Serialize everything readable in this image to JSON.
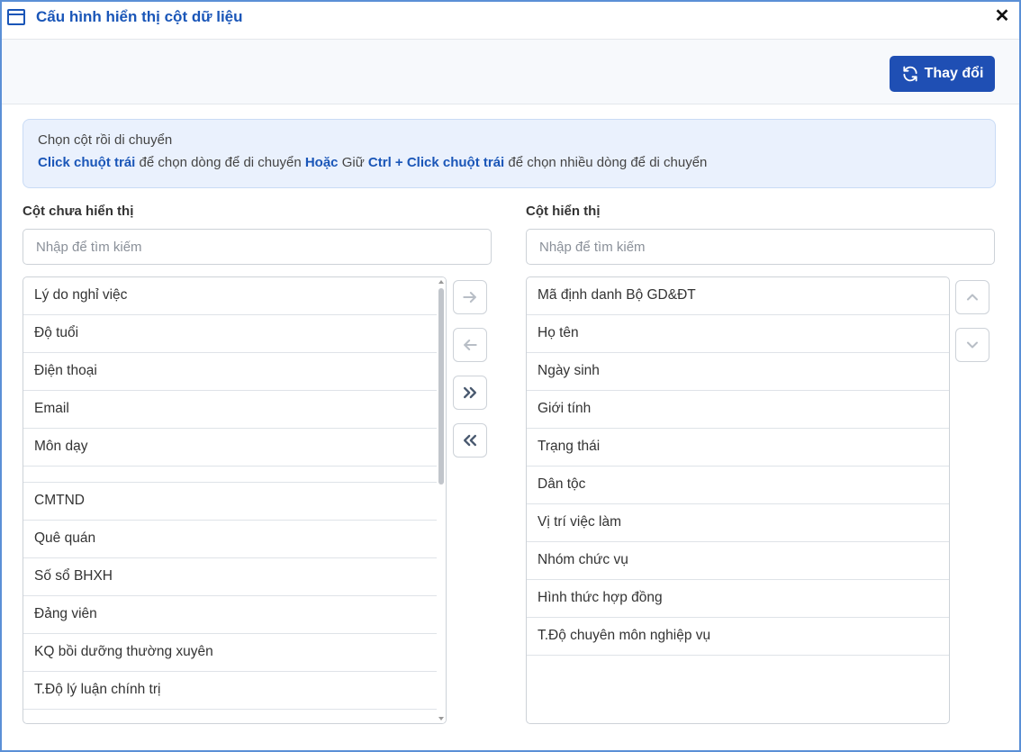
{
  "dialog": {
    "title": "Cấu hình hiển thị cột dữ liệu",
    "close_glyph": "✕",
    "change_label": "Thay đổi"
  },
  "info": {
    "line1": "Chọn cột rồi di chuyển",
    "click_left": "Click chuột trái",
    "text_a": " để chọn dòng để di chuyển ",
    "or": "Hoặc",
    "text_b": " Giữ ",
    "ctrl_click": "Ctrl + Click chuột trái",
    "text_c": " để chọn nhiều dòng để di chuyển"
  },
  "hidden": {
    "label": "Cột chưa hiển thị",
    "placeholder": "Nhập để tìm kiếm",
    "items": [
      "Lý do nghỉ việc",
      "Độ tuổi",
      "Điện thoại",
      "Email",
      "Môn dạy",
      "",
      "CMTND",
      "Quê quán",
      "Số sổ BHXH",
      "Đảng viên",
      "KQ bồi dưỡng thường xuyên",
      "T.Độ lý luận chính trị"
    ]
  },
  "shown": {
    "label": "Cột hiển thị",
    "placeholder": "Nhập để tìm kiếm",
    "items": [
      "Mã định danh Bộ GD&ĐT",
      "Họ tên",
      "Ngày sinh",
      "Giới tính",
      "Trạng thái",
      "Dân tộc",
      "Vị trí việc làm",
      "Nhóm chức vụ",
      "Hình thức hợp đồng",
      "T.Độ chuyên môn nghiệp vụ"
    ]
  },
  "colors": {
    "accent": "#1a56b8",
    "button": "#1f4fb4",
    "info_bg": "#eaf1fd"
  }
}
